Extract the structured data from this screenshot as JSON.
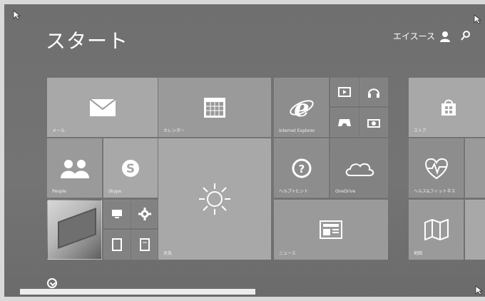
{
  "start": {
    "title": "スタート",
    "user_name": "エイスース"
  },
  "tiles": {
    "mail": "メール",
    "calendar": "カレンダー",
    "ie": "Internet Explorer",
    "people": "People",
    "skype": "Skype",
    "weather": "天気",
    "help": "ヘルプ+ヒント",
    "onedrive": "OneDrive",
    "news": "ニュース",
    "store": "ストア",
    "health": "ヘルス&フィットネス",
    "maps": "地図"
  },
  "icons": {
    "mail": "envelope-icon",
    "calendar": "calendar-grid-icon",
    "ie": "internet-explorer-icon",
    "video": "video-icon",
    "music": "headphones-icon",
    "games": "game-controller-icon",
    "camera": "camera-icon",
    "people": "people-icon",
    "skype": "skype-icon",
    "weather": "sun-icon",
    "help": "question-icon",
    "onedrive": "cloud-icon",
    "news": "newspaper-icon",
    "store": "shopping-bag-icon",
    "health": "heart-pulse-icon",
    "maps": "map-icon",
    "settings": "gear-icon"
  }
}
